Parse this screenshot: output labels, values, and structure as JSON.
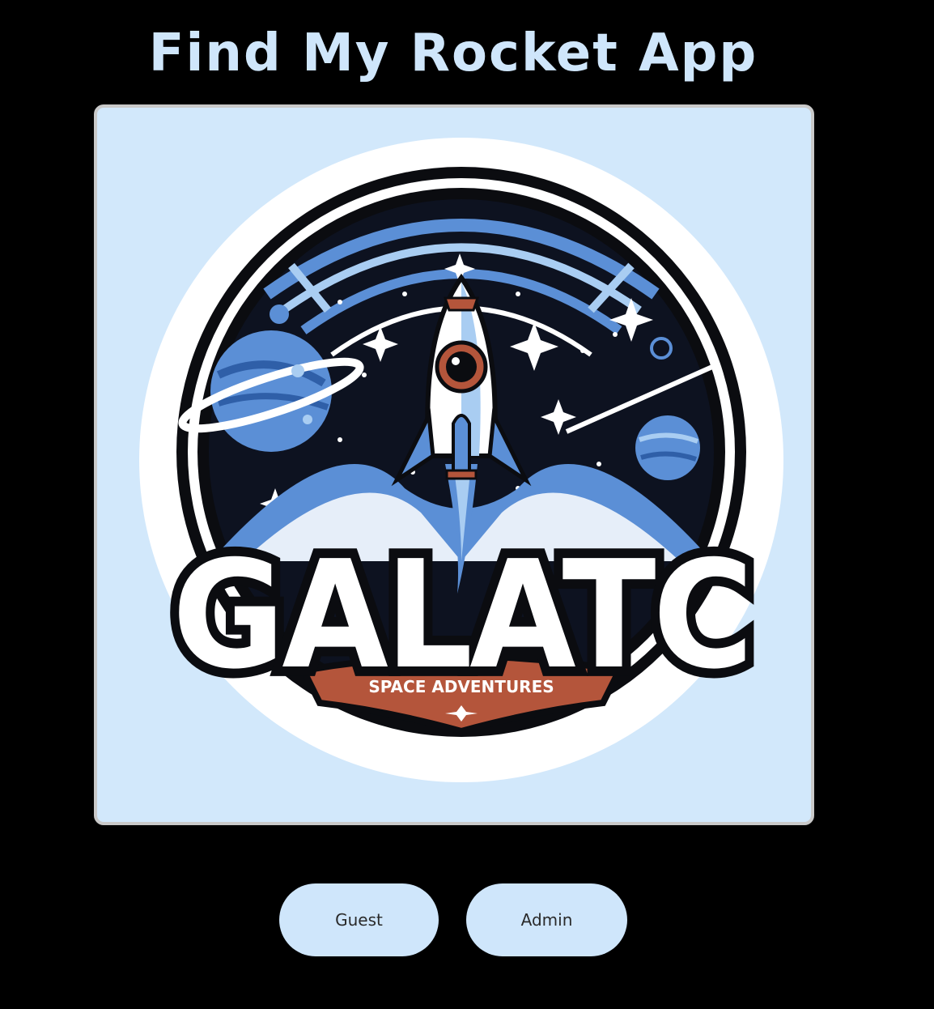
{
  "app": {
    "title": "Find My Rocket App"
  },
  "logo": {
    "wordmark": "GALATC",
    "tagline": "SPACE ADVENTURES",
    "colors": {
      "card_bg": "#d2e8fb",
      "ring_white": "#ffffff",
      "ring_black": "#0b0c10",
      "blue": "#5b8fd6",
      "light_blue": "#a9cdf2",
      "rust": "#b4553b"
    }
  },
  "actions": {
    "guest_label": "Guest",
    "admin_label": "Admin"
  }
}
